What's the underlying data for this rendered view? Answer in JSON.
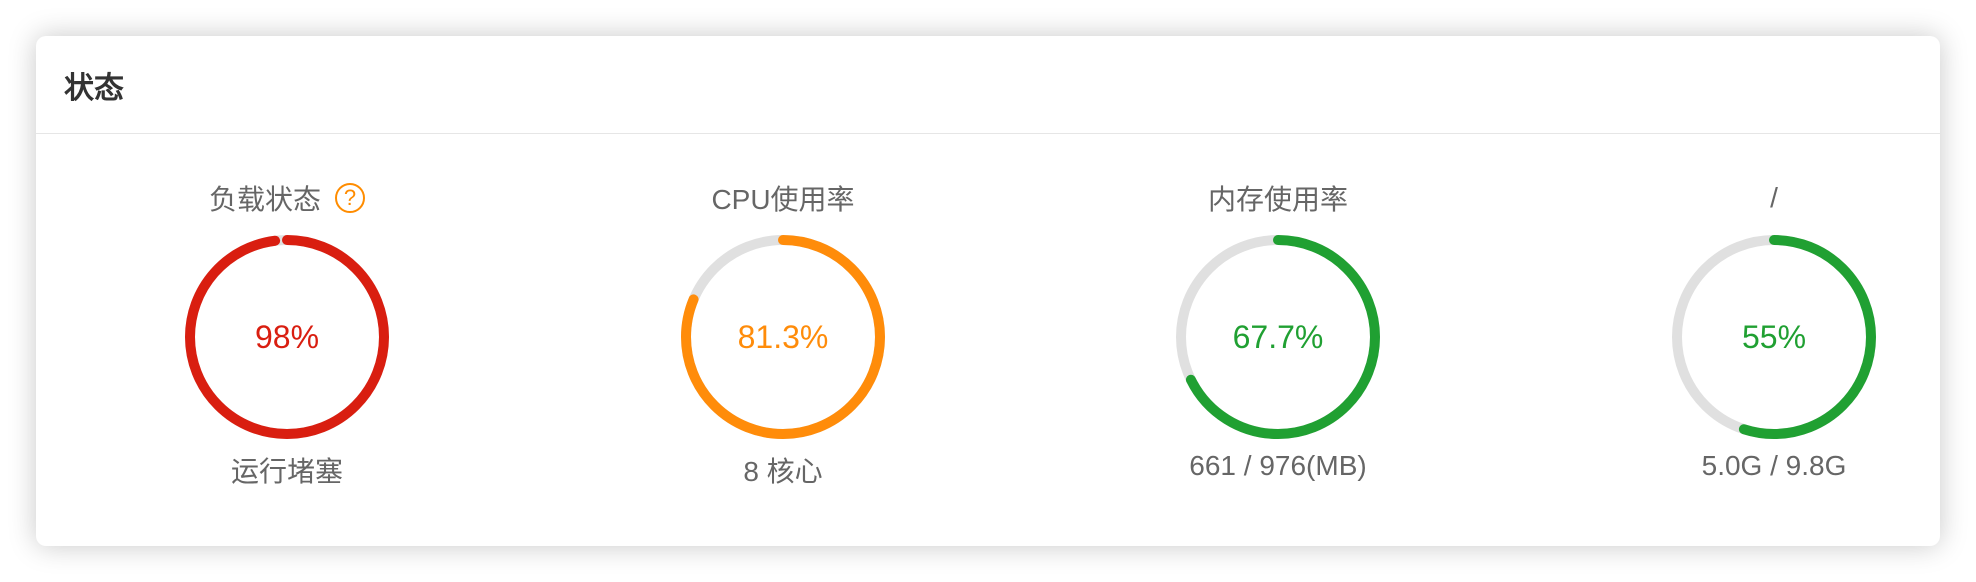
{
  "panel": {
    "title": "状态"
  },
  "gauges": [
    {
      "title": "负载状态",
      "has_help": true,
      "percent": 98,
      "percent_text": "98%",
      "sub": "运行堵塞",
      "color": "#d91e10"
    },
    {
      "title": "CPU使用率",
      "has_help": false,
      "percent": 81.3,
      "percent_text": "81.3%",
      "sub": "8 核心",
      "color": "#ff8c0a"
    },
    {
      "title": "内存使用率",
      "has_help": false,
      "percent": 67.7,
      "percent_text": "67.7%",
      "sub": "661 / 976(MB)",
      "color": "#20a032"
    },
    {
      "title": "/",
      "has_help": false,
      "percent": 55,
      "percent_text": "55%",
      "sub": "5.0G / 9.8G",
      "color": "#20a032"
    }
  ],
  "help_icon": {
    "glyph": "?",
    "color": "#ff8c00",
    "icon": "question-circle-icon"
  },
  "track_color": "#e0e0e0"
}
